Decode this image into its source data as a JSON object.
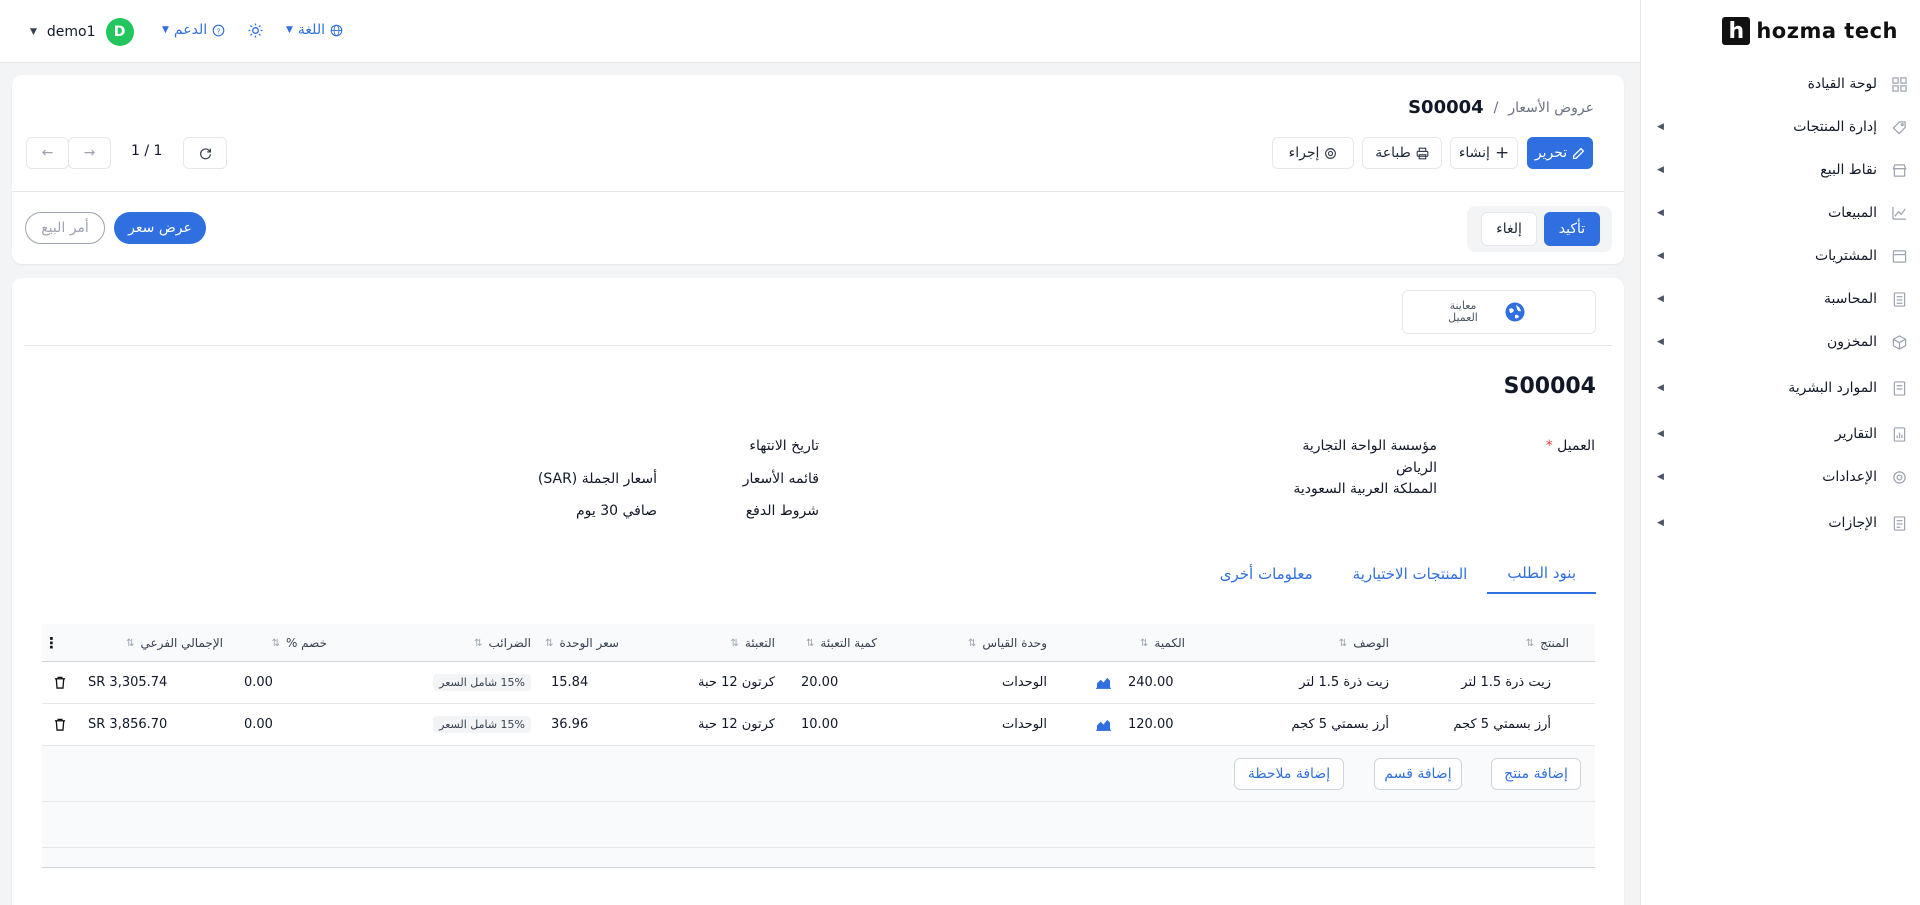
{
  "topbar": {
    "username": "demo1",
    "avatar_initial": "D",
    "support_label": "الدعم",
    "language_label": "اللغة"
  },
  "sidebar": {
    "brand": "hozma tech",
    "brand_mark": "h",
    "items": [
      {
        "label": "لوحة القيادة",
        "icon": "dashboard-icon"
      },
      {
        "label": "إدارة المنتجات",
        "icon": "tag-icon"
      },
      {
        "label": "نقاط البيع",
        "icon": "store-icon"
      },
      {
        "label": "المبيعات",
        "icon": "chart-line-icon"
      },
      {
        "label": "المشتريات",
        "icon": "cart-icon"
      },
      {
        "label": "المحاسبة",
        "icon": "calculator-icon"
      },
      {
        "label": "المخزون",
        "icon": "box-icon"
      },
      {
        "label": "الموارد البشرية",
        "icon": "people-icon"
      },
      {
        "label": "التقارير",
        "icon": "report-icon"
      },
      {
        "label": "الإعدادات",
        "icon": "gear-icon"
      },
      {
        "label": "الإجازات",
        "icon": "calendar-icon"
      }
    ]
  },
  "breadcrumb": {
    "parent": "عروض الأسعار",
    "separator": "/",
    "current": "S00004"
  },
  "toolbar": {
    "edit": "تحرير",
    "create": "إنشاء",
    "print": "طباعة",
    "action": "إجراء",
    "pager": "1 / 1"
  },
  "status": {
    "confirm": "تأكيد",
    "cancel": "إلغاء",
    "stage_quote": "عرض سعر",
    "stage_order": "أمر البيع"
  },
  "form": {
    "preview_label": "معاينة العميل",
    "title": "S00004",
    "customer_label": "العميل",
    "required_mark": "*",
    "customer_name": "مؤسسة الواحة التجارية",
    "customer_city": "الرياض",
    "customer_country": "المملكة العربية السعودية",
    "expiry_label": "تاريخ الانتهاء",
    "pricelist_label": "قائمه الأسعار",
    "pricelist_value": "أسعار الجملة (SAR)",
    "payment_terms_label": "شروط الدفع",
    "payment_terms_value": "صافي 30 يوم"
  },
  "tabs": [
    "بنود الطلب",
    "المنتجات الاختيارية",
    "معلومات أخرى"
  ],
  "table": {
    "headers": {
      "product": "المنتج",
      "description": "الوصف",
      "quantity": "الكمية",
      "uom": "وحدة القياس",
      "packaging_qty": "كمية التعبئة",
      "packaging": "التعبئة",
      "unit_price": "سعر الوحدة",
      "taxes": "الضرائب",
      "discount": "خصم %",
      "subtotal": "الإجمالي الفرعي"
    },
    "rows": [
      {
        "product": "زيت ذرة 1.5 لتر",
        "description": "زيت ذرة 1.5 لتر",
        "quantity": "240.00",
        "uom": "الوحدات",
        "packaging_qty": "20.00",
        "packaging": "كرتون 12 حبة",
        "unit_price": "15.84",
        "tax": "15% شامل السعر",
        "discount": "0.00",
        "subtotal": "SR 3,305.74"
      },
      {
        "product": "أرز بسمتي 5 كجم",
        "description": "أرز بسمتي 5 كجم",
        "quantity": "120.00",
        "uom": "الوحدات",
        "packaging_qty": "10.00",
        "packaging": "كرتون 12 حبة",
        "unit_price": "36.96",
        "tax": "15% شامل السعر",
        "discount": "0.00",
        "subtotal": "SR 3,856.70"
      }
    ],
    "add_product": "إضافة منتج",
    "add_section": "إضافة قسم",
    "add_note": "إضافة ملاحظة"
  },
  "colors": {
    "primary": "#2f6fe0",
    "avatar": "#22c55e"
  }
}
